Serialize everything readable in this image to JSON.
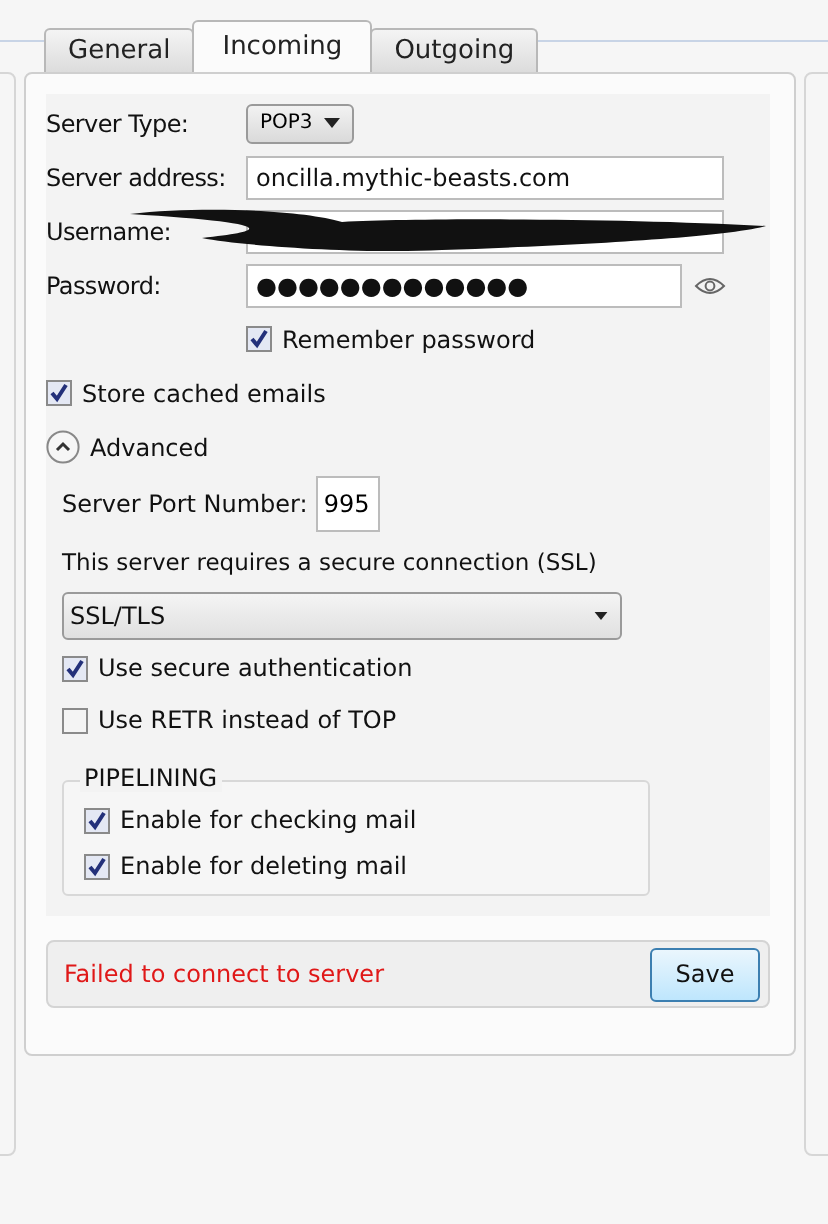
{
  "tabs": [
    {
      "label": "General",
      "selected": false
    },
    {
      "label": "Incoming",
      "selected": true
    },
    {
      "label": "Outgoing",
      "selected": false
    }
  ],
  "server_type": {
    "label": "Server Type:",
    "value": "POP3"
  },
  "server_address": {
    "label": "Server address:",
    "value": "oncilla.mythic-beasts.com"
  },
  "username": {
    "label": "Username:",
    "redacted": true
  },
  "password": {
    "label": "Password:",
    "value": "●●●●●●●●●●●●●"
  },
  "remember_password": {
    "label": "Remember password",
    "checked": true
  },
  "store_cached": {
    "label": "Store cached emails",
    "checked": true
  },
  "advanced": {
    "label": "Advanced",
    "expanded": true,
    "port": {
      "label": "Server Port Number:",
      "value": "995"
    },
    "ssl": {
      "label": "This server requires a secure connection (SSL)",
      "value": "SSL/TLS"
    },
    "options": [
      {
        "label": "Use secure authentication",
        "checked": true
      },
      {
        "label": "Use RETR instead of TOP",
        "checked": false
      }
    ],
    "pipelining": {
      "title": "PIPELINING",
      "options": [
        {
          "label": "Enable for checking mail",
          "checked": true
        },
        {
          "label": "Enable for deleting mail",
          "checked": true
        }
      ]
    }
  },
  "status": {
    "message": "Failed to connect to server",
    "button": "Save"
  }
}
